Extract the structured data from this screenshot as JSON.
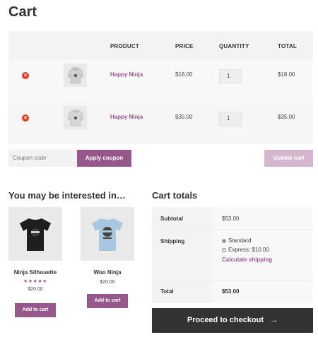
{
  "page": {
    "title": "Cart"
  },
  "cart_table": {
    "headers": {
      "product": "PRODUCT",
      "price": "PRICE",
      "quantity": "QUANTITY",
      "total": "TOTAL"
    },
    "rows": [
      {
        "name": "Happy Ninja",
        "price": "$18.00",
        "quantity": "1",
        "total": "$18.00"
      },
      {
        "name": "Happy Ninja",
        "price": "$35.00",
        "quantity": "1",
        "total": "$35.00"
      }
    ]
  },
  "coupon": {
    "placeholder": "Coupon code",
    "apply_label": "Apply coupon"
  },
  "update_label": "Update cart",
  "cross_sells": {
    "title": "You may be interested in…",
    "products": [
      {
        "name": "Ninja Silhouette",
        "price": "$20.00",
        "rating_stars": 5,
        "button_label": "Add to cart",
        "shirt_color": "#1e1e1e"
      },
      {
        "name": "Woo Ninja",
        "price": "$20.00",
        "button_label": "Add to cart",
        "shirt_color": "#a9c6e0"
      }
    ]
  },
  "cart_totals": {
    "title": "Cart totals",
    "subtotal_label": "Subtotal",
    "subtotal_value": "$53.00",
    "shipping_label": "Shipping",
    "shipping_options": [
      "Standard",
      "Express: $10.00"
    ],
    "shipping_selected": "Standard",
    "calculate_shipping": "Calculate shipping",
    "total_label": "Total",
    "total_value": "$53.00"
  },
  "checkout": {
    "label": "Proceed to checkout",
    "arrow": "→"
  },
  "colors": {
    "accent": "#96588a",
    "remove": "#e2401c",
    "dark_button": "#333333"
  }
}
